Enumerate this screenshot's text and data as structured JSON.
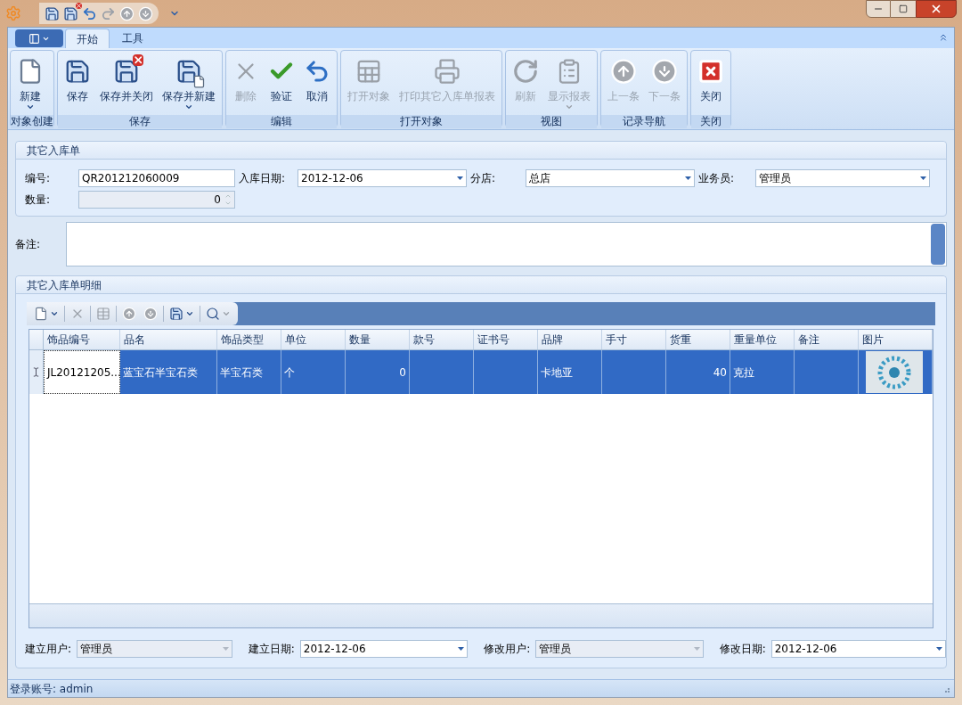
{
  "quick_access": [
    {
      "kind": "save",
      "disabled": false
    },
    {
      "kind": "save-close",
      "disabled": false
    },
    {
      "kind": "undo",
      "disabled": false
    },
    {
      "kind": "redo",
      "disabled": true
    },
    {
      "kind": "up",
      "disabled": true
    },
    {
      "kind": "down",
      "disabled": true
    }
  ],
  "ribbon": {
    "tabs": [
      {
        "label": "开始",
        "selected": true
      },
      {
        "label": "工具",
        "selected": false
      }
    ],
    "groups": [
      {
        "title": "对象创建",
        "buttons": [
          {
            "label": "新建",
            "kind": "new",
            "disabled": false,
            "dropdown": true
          }
        ]
      },
      {
        "title": "保存",
        "buttons": [
          {
            "label": "保存",
            "kind": "save",
            "disabled": false,
            "dropdown": false
          },
          {
            "label": "保存并关闭",
            "kind": "save-close",
            "disabled": false,
            "dropdown": false
          },
          {
            "label": "保存并新建",
            "kind": "save-new",
            "disabled": false,
            "dropdown": true
          }
        ]
      },
      {
        "title": "编辑",
        "buttons": [
          {
            "label": "删除",
            "kind": "delete",
            "disabled": true,
            "dropdown": false
          },
          {
            "label": "验证",
            "kind": "verify",
            "disabled": false,
            "dropdown": false
          },
          {
            "label": "取消",
            "kind": "cancel",
            "disabled": false,
            "dropdown": false
          }
        ]
      },
      {
        "title": "打开对象",
        "buttons": [
          {
            "label": "打开对象",
            "kind": "open",
            "disabled": true,
            "dropdown": false
          },
          {
            "label": "打印其它入库单报表",
            "kind": "print",
            "disabled": true,
            "dropdown": false
          }
        ]
      },
      {
        "title": "视图",
        "buttons": [
          {
            "label": "刷新",
            "kind": "refresh",
            "disabled": true,
            "dropdown": false
          },
          {
            "label": "显示报表",
            "kind": "report",
            "disabled": true,
            "dropdown": true
          }
        ]
      },
      {
        "title": "记录导航",
        "buttons": [
          {
            "label": "上一条",
            "kind": "up",
            "disabled": true,
            "dropdown": false
          },
          {
            "label": "下一条",
            "kind": "down",
            "disabled": true,
            "dropdown": false
          }
        ]
      },
      {
        "title": "关闭",
        "buttons": [
          {
            "label": "关闭",
            "kind": "close",
            "disabled": false,
            "dropdown": false
          }
        ]
      }
    ]
  },
  "header": {
    "title": "其它入库单",
    "fields": [
      {
        "label": "编号:",
        "value": "QR201212060009",
        "kind": "text",
        "disabled": false
      },
      {
        "label": "入库日期:",
        "value": "2012-12-06",
        "kind": "combo",
        "disabled": false
      },
      {
        "label": "分店:",
        "value": "总店",
        "kind": "combo",
        "disabled": false
      },
      {
        "label": "业务员:",
        "value": "管理员",
        "kind": "combo",
        "disabled": false
      },
      {
        "label": "数量:",
        "value": "0",
        "kind": "spin",
        "disabled": true
      }
    ]
  },
  "remarks": {
    "label": "备注:"
  },
  "detail": {
    "title": "其它入库单明细",
    "toolbar": [
      {
        "kind": "new",
        "dropdown": true,
        "disabled": false
      },
      {
        "kind": "delete",
        "dropdown": false,
        "disabled": true
      },
      {
        "kind": "edit",
        "dropdown": false,
        "disabled": true
      },
      {
        "kind": "up",
        "dropdown": false,
        "disabled": true
      },
      {
        "kind": "down",
        "dropdown": false,
        "disabled": true
      },
      {
        "kind": "save",
        "dropdown": true,
        "disabled": false
      },
      {
        "kind": "find",
        "dropdown": true,
        "disabled": false
      }
    ],
    "table": {
      "columns": [
        {
          "title": "饰品编号"
        },
        {
          "title": "品名"
        },
        {
          "title": "饰品类型"
        },
        {
          "title": "单位"
        },
        {
          "title": "数量"
        },
        {
          "title": "款号"
        },
        {
          "title": "证书号"
        },
        {
          "title": "品牌"
        },
        {
          "title": "手寸"
        },
        {
          "title": "货重"
        },
        {
          "title": "重量单位"
        },
        {
          "title": "备注"
        },
        {
          "title": "图片",
          "kind": "image"
        }
      ],
      "rows": [
        {
          "selected": true,
          "cells": [
            {
              "text": "JL20121205...",
              "focused": true,
              "numeric": false
            },
            {
              "text": "蓝宝石半宝石类",
              "focused": false,
              "numeric": false
            },
            {
              "text": "半宝石类",
              "focused": false,
              "numeric": false
            },
            {
              "text": "个",
              "focused": false,
              "numeric": false
            },
            {
              "text": "0",
              "focused": false,
              "numeric": true
            },
            null,
            null,
            {
              "text": "卡地亚",
              "focused": false,
              "numeric": false
            },
            null,
            {
              "text": "40",
              "focused": false,
              "numeric": true
            },
            {
              "text": "克拉",
              "focused": false,
              "numeric": false
            },
            null,
            {
              "kind": "image",
              "focused": false
            }
          ]
        }
      ]
    },
    "footer_fields": [
      {
        "label": "建立用户:",
        "value": "管理员",
        "disabled": true
      },
      {
        "label": "建立日期:",
        "value": "2012-12-06",
        "disabled": false
      },
      {
        "label": "修改用户:",
        "value": "管理员",
        "disabled": true
      },
      {
        "label": "修改日期:",
        "value": "2012-12-06",
        "disabled": false
      }
    ]
  },
  "status_bar": {
    "text": "登录账号: admin"
  }
}
